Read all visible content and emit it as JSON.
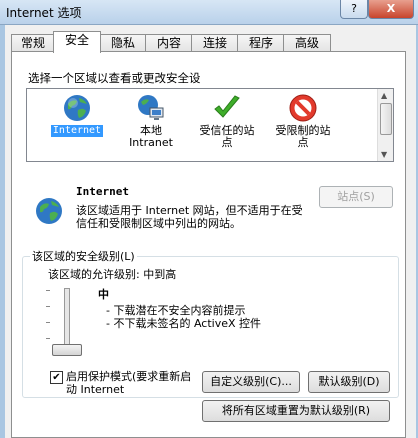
{
  "window": {
    "title": "Internet 选项",
    "help": "?",
    "close": "X"
  },
  "tabs": [
    {
      "label": "常规"
    },
    {
      "label": "安全"
    },
    {
      "label": "隐私"
    },
    {
      "label": "内容"
    },
    {
      "label": "连接"
    },
    {
      "label": "程序"
    },
    {
      "label": "高级"
    }
  ],
  "active_tab": "安全",
  "security": {
    "prompt": "选择一个区域以查看或更改安全设",
    "zones": [
      {
        "label": "Internet",
        "icon": "globe-icon",
        "selected": true
      },
      {
        "label": "本地\nIntranet",
        "icon": "intranet-icon",
        "selected": false
      },
      {
        "label": "受信任的站\n点",
        "icon": "checkmark-icon",
        "selected": false
      },
      {
        "label": "受限制的站\n点",
        "icon": "no-entry-icon",
        "selected": false
      }
    ],
    "selected_zone": {
      "title": "Internet",
      "description": "该区域适用于 Internet 网站，但不适用于在受信任和受限制区域中列出的网站。",
      "sites_button": "站点(S)"
    },
    "level_group": {
      "legend": "该区域的安全级别(L)",
      "allowed": "该区域的允许级别: 中到高",
      "level": "中",
      "details": [
        "- 下载潜在不安全内容前提示",
        "- 不下载未签名的 ActiveX 控件"
      ],
      "protected_mode_label": "启用保护模式(要求重新启动 Internet",
      "protected_mode_checked": true,
      "custom_button": "自定义级别(C)...",
      "default_button": "默认级别(D)"
    },
    "reset_all_button": "将所有区域重置为默认级别(R)"
  }
}
